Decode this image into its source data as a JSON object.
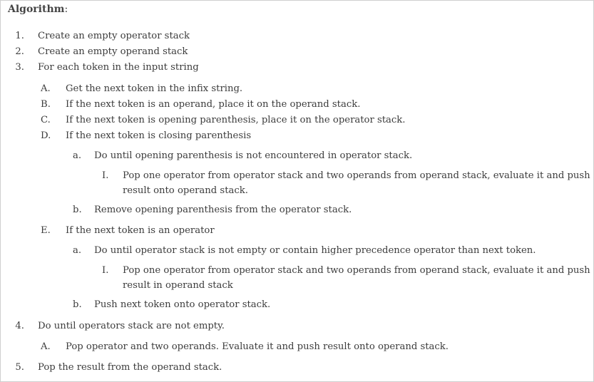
{
  "heading": "Algorithm",
  "heading_colon": ":",
  "steps": [
    {
      "marker": "1.",
      "text": "Create an empty operator stack"
    },
    {
      "marker": "2.",
      "text": "Create an empty operand stack"
    },
    {
      "marker": "3.",
      "text": "For each token in the input string"
    },
    {
      "marker": "A.",
      "text": "Get the next token in the infix string."
    },
    {
      "marker": "B.",
      "text": "If the next token is an operand, place it on the operand stack."
    },
    {
      "marker": "C.",
      "text": "If the next token is opening parenthesis, place it on the operator stack."
    },
    {
      "marker": "D.",
      "text": "If the next token is closing parenthesis"
    },
    {
      "marker": "a.",
      "text": "Do until opening parenthesis is not encountered in operator stack."
    },
    {
      "marker": "I.",
      "text": "Pop one operator from operator stack and two operands from operand stack, evaluate it and push result onto operand stack."
    },
    {
      "marker": "b.",
      "text": "Remove opening parenthesis from the operator stack."
    },
    {
      "marker": "E.",
      "text": "If the next token is an operator"
    },
    {
      "marker": "a.",
      "text": "Do until operator stack is not empty or contain higher precedence operator than next token."
    },
    {
      "marker": "I.",
      "text": "Pop one operator from operator stack and two operands from operand stack, evaluate it and push result in operand stack"
    },
    {
      "marker": "b.",
      "text": "Push next token onto operator stack."
    },
    {
      "marker": "4.",
      "text": "Do until operators stack are not empty."
    },
    {
      "marker": "A.",
      "text": "Pop operator and two operands. Evaluate it and push result onto operand stack."
    },
    {
      "marker": "5.",
      "text": "Pop the result from the operand stack."
    }
  ]
}
